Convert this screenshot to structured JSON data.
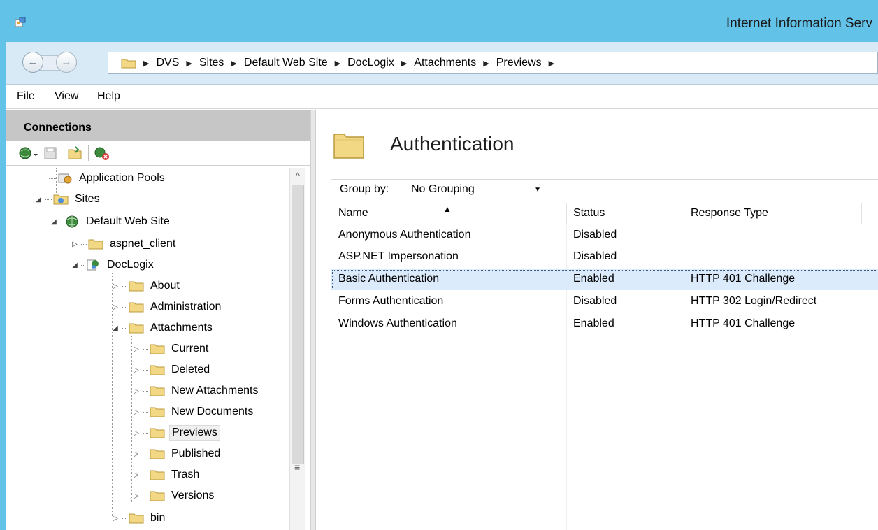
{
  "window": {
    "title": "Internet Information Serv"
  },
  "address": {
    "crumbs": [
      "DVS",
      "Sites",
      "Default Web Site",
      "DocLogix",
      "Attachments",
      "Previews"
    ]
  },
  "menu": {
    "file": "File",
    "view": "View",
    "help": "Help"
  },
  "connections": {
    "title": "Connections",
    "tree": [
      {
        "label": "Application Pools",
        "icon": "app-pool-icon"
      },
      {
        "label": "Sites",
        "icon": "sites-icon",
        "expanded": true
      },
      {
        "label": "Default Web Site",
        "icon": "globe-icon",
        "expanded": true
      },
      {
        "label": "aspnet_client",
        "icon": "folder-icon"
      },
      {
        "label": "DocLogix",
        "icon": "application-icon",
        "expanded": true
      },
      {
        "label": "About",
        "icon": "folder-icon"
      },
      {
        "label": "Administration",
        "icon": "folder-icon"
      },
      {
        "label": "Attachments",
        "icon": "folder-icon",
        "expanded": true
      },
      {
        "label": "Current",
        "icon": "folder-icon"
      },
      {
        "label": "Deleted",
        "icon": "folder-icon"
      },
      {
        "label": "New Attachments",
        "icon": "folder-icon"
      },
      {
        "label": "New Documents",
        "icon": "folder-icon"
      },
      {
        "label": "Previews",
        "icon": "folder-icon",
        "selected": true
      },
      {
        "label": "Published",
        "icon": "folder-icon"
      },
      {
        "label": "Trash",
        "icon": "folder-icon"
      },
      {
        "label": "Versions",
        "icon": "folder-icon"
      },
      {
        "label": "bin",
        "icon": "folder-icon"
      }
    ]
  },
  "feature": {
    "title": "Authentication",
    "group_by_label": "Group by:",
    "group_by_value": "No Grouping",
    "columns": [
      "Name",
      "Status",
      "Response Type"
    ],
    "rows": [
      {
        "name": "Anonymous Authentication",
        "status": "Disabled",
        "response": ""
      },
      {
        "name": "ASP.NET Impersonation",
        "status": "Disabled",
        "response": ""
      },
      {
        "name": "Basic Authentication",
        "status": "Enabled",
        "response": "HTTP 401 Challenge",
        "selected": true
      },
      {
        "name": "Forms Authentication",
        "status": "Disabled",
        "response": "HTTP 302 Login/Redirect"
      },
      {
        "name": "Windows Authentication",
        "status": "Enabled",
        "response": "HTTP 401 Challenge"
      }
    ]
  },
  "colors": {
    "titlebar": "#62c2e8",
    "selection": "#dcebfc",
    "folder": "#f2d785"
  }
}
